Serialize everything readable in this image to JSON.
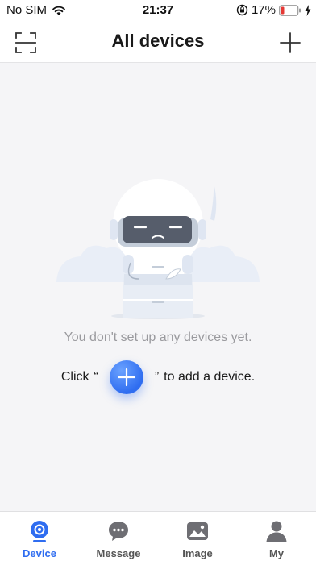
{
  "status_bar": {
    "carrier": "No SIM",
    "time": "21:37",
    "battery": "17%"
  },
  "nav": {
    "title": "All devices"
  },
  "empty_state": {
    "message": "You don't set up any devices yet.",
    "hint_prefix": "Click",
    "open_quote": "“",
    "close_quote": "”",
    "hint_suffix": "to add a device."
  },
  "tabs": [
    {
      "label": "Device",
      "icon": "device-icon",
      "active": true
    },
    {
      "label": "Message",
      "icon": "message-icon",
      "active": false
    },
    {
      "label": "Image",
      "icon": "image-icon",
      "active": false
    },
    {
      "label": "My",
      "icon": "profile-icon",
      "active": false
    }
  ],
  "colors": {
    "accent": "#2f6df0",
    "inactive": "#555555",
    "battery_low": "#e53935"
  }
}
